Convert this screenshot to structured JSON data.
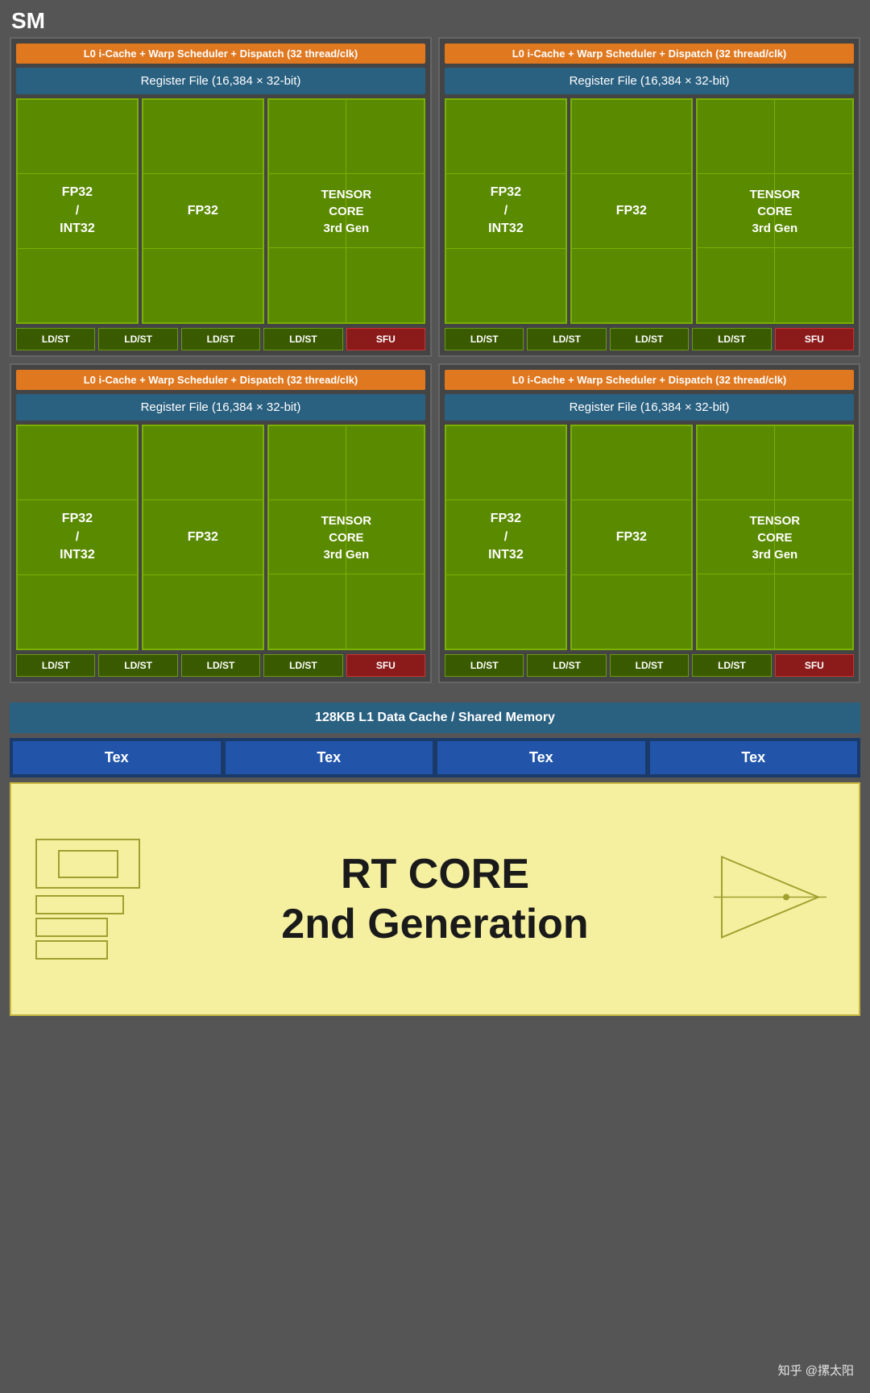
{
  "sm_label": "SM",
  "sub_sms": [
    {
      "id": "sub-sm-1",
      "l0_label": "L0 i-Cache + Warp Scheduler + Dispatch (32 thread/clk)",
      "register_file": "Register File (16,384 × 32-bit)",
      "fp32_int32_label": "FP32\n/\nINT32",
      "fp32_label": "FP32",
      "tensor_label": "TENSOR\nCORE\n3rd Gen",
      "ldst_labels": [
        "LD/ST",
        "LD/ST",
        "LD/ST",
        "LD/ST"
      ],
      "sfu_label": "SFU"
    },
    {
      "id": "sub-sm-2",
      "l0_label": "L0 i-Cache + Warp Scheduler + Dispatch (32 thread/clk)",
      "register_file": "Register File (16,384 × 32-bit)",
      "fp32_int32_label": "FP32\n/\nINT32",
      "fp32_label": "FP32",
      "tensor_label": "TENSOR\nCORE\n3rd Gen",
      "ldst_labels": [
        "LD/ST",
        "LD/ST",
        "LD/ST",
        "LD/ST"
      ],
      "sfu_label": "SFU"
    },
    {
      "id": "sub-sm-3",
      "l0_label": "L0 i-Cache + Warp Scheduler + Dispatch (32 thread/clk)",
      "register_file": "Register File (16,384 × 32-bit)",
      "fp32_int32_label": "FP32\n/\nINT32",
      "fp32_label": "FP32",
      "tensor_label": "TENSOR\nCORE\n3rd Gen",
      "ldst_labels": [
        "LD/ST",
        "LD/ST",
        "LD/ST",
        "LD/ST"
      ],
      "sfu_label": "SFU"
    },
    {
      "id": "sub-sm-4",
      "l0_label": "L0 i-Cache + Warp Scheduler + Dispatch (32 thread/clk)",
      "register_file": "Register File (16,384 × 32-bit)",
      "fp32_int32_label": "FP32\n/\nINT32",
      "fp32_label": "FP32",
      "tensor_label": "TENSOR\nCORE\n3rd Gen",
      "ldst_labels": [
        "LD/ST",
        "LD/ST",
        "LD/ST",
        "LD/ST"
      ],
      "sfu_label": "SFU"
    }
  ],
  "l1_cache_label": "128KB L1 Data Cache / Shared Memory",
  "tex_labels": [
    "Tex",
    "Tex",
    "Tex",
    "Tex"
  ],
  "rt_core_label": "RT CORE\n2nd Generation",
  "watermark": "知乎 @摞太阳"
}
